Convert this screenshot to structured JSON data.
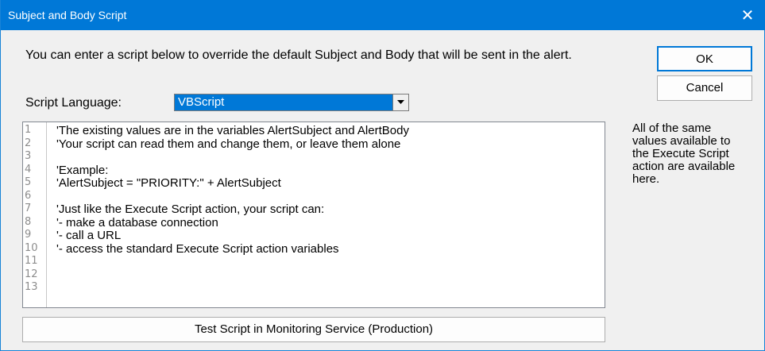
{
  "window": {
    "title": "Subject and Body Script",
    "close_glyph": "✕"
  },
  "intro_text": "You can enter a script below to override the default Subject and Body that will be sent in the alert.",
  "buttons": {
    "ok": "OK",
    "cancel": "Cancel",
    "test_script": "Test Script in Monitoring Service (Production)"
  },
  "script_language": {
    "label": "Script Language:",
    "selected": "VBScript"
  },
  "editor": {
    "line_numbers": [
      "1",
      "2",
      "3",
      "4",
      "5",
      "6",
      "7",
      "8",
      "9",
      "10",
      "11",
      "12",
      "13"
    ],
    "lines": [
      "'The existing values are in the variables AlertSubject and AlertBody",
      "'Your script can read them and change them, or leave them alone",
      "",
      "'Example:",
      "'AlertSubject = \"PRIORITY:\" + AlertSubject",
      "",
      "'Just like the Execute Script action, your script can:",
      "'- make a database connection",
      "'- call a URL",
      "'- access the standard Execute Script action variables",
      "",
      "",
      ""
    ]
  },
  "side_note": "All of the same values available to the Execute Script action are available here.",
  "colors": {
    "titlebar": "#0078d7",
    "dialog_bg": "#f0f0f0",
    "selection": "#0078d7"
  }
}
